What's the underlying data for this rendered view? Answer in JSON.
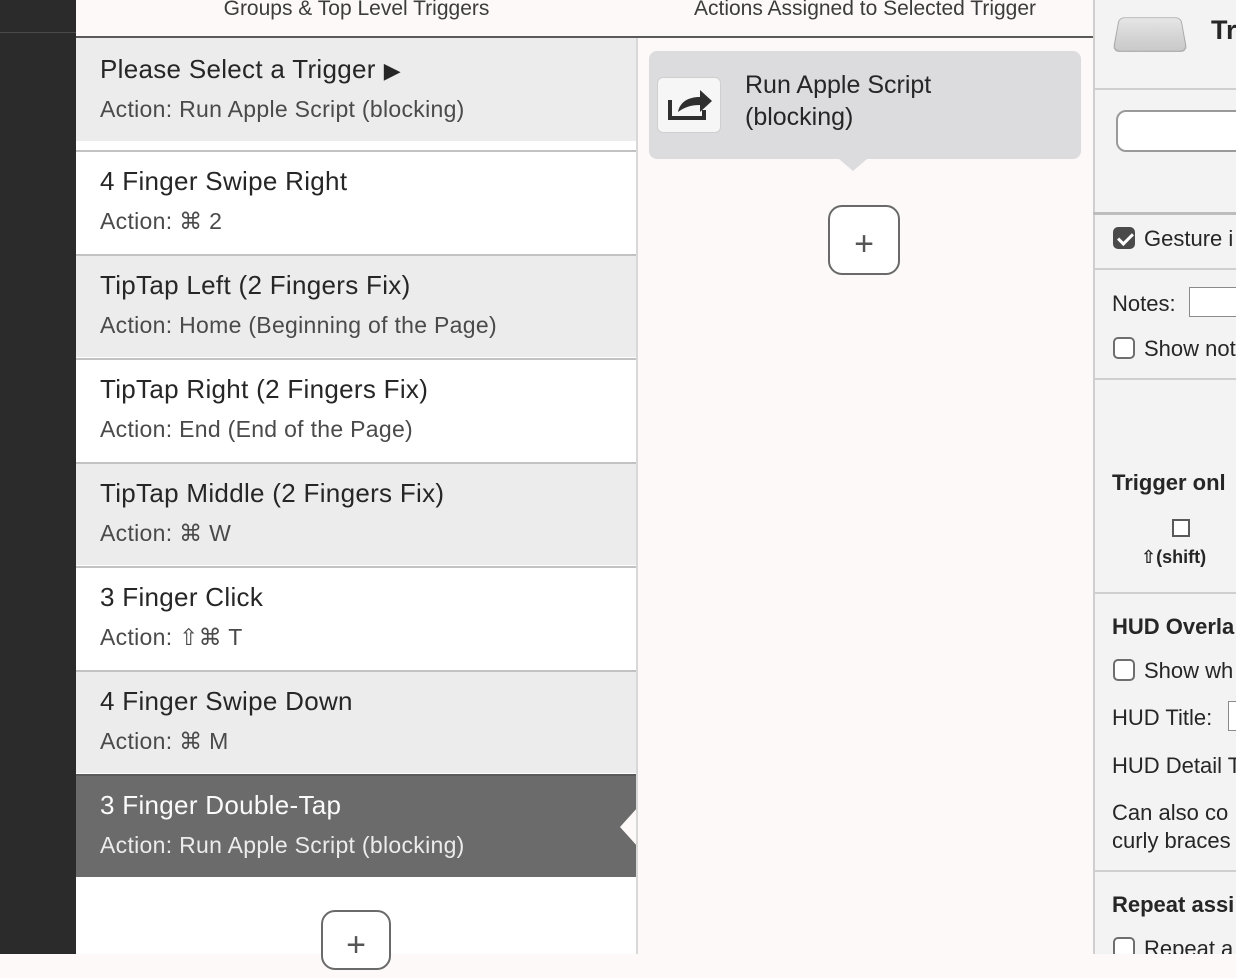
{
  "headers": {
    "left": "Groups & Top Level Triggers",
    "middle": "Actions Assigned to Selected Trigger"
  },
  "triggers": [
    {
      "title": "Please Select a Trigger",
      "action": "Action: Run Apple Script (blocking)",
      "has_arrow": true
    },
    {
      "title": "4 Finger Swipe Right",
      "action": "Action: ⌘ 2"
    },
    {
      "title": "TipTap Left (2 Fingers Fix)",
      "action": "Action: Home (Beginning of the Page)"
    },
    {
      "title": "TipTap Right (2 Fingers Fix)",
      "action": "Action: End (End of the Page)"
    },
    {
      "title": "TipTap Middle (2 Fingers Fix)",
      "action": "Action: ⌘ W"
    },
    {
      "title": "3 Finger Click",
      "action": "Action: ⇧⌘ T"
    },
    {
      "title": "4 Finger Swipe Down",
      "action": "Action: ⌘ M"
    },
    {
      "title": "3 Finger Double-Tap",
      "action": "Action: Run Apple Script (blocking)",
      "selected": true
    }
  ],
  "arrow_glyph": "▶",
  "add_label": "+",
  "actions": [
    {
      "title": "Run Apple Script (blocking)",
      "icon": "share-arrow-icon"
    }
  ],
  "right_panel": {
    "title_partial": "Tr",
    "gesture_checkbox_label": "Gesture i",
    "gesture_checked": true,
    "notes_label": "Notes:",
    "show_notes_label": "Show not",
    "trigger_only_label": "Trigger onl",
    "shift_label": "⇧(shift)",
    "hud_overlay_label": "HUD Overla",
    "show_when_label": "Show wh",
    "hud_title_label": "HUD Title:",
    "hud_detail_label": "HUD Detail T",
    "can_also_line1": "Can also co",
    "can_also_line2": "curly braces",
    "repeat_label": "Repeat assi",
    "repeat_checkbox_label": "Repeat a"
  },
  "colors": {
    "selected_row": "#6b6b6b",
    "alt_row": "#ececec",
    "sidebar": "#2b2b2b",
    "card": "#dcdcde"
  }
}
